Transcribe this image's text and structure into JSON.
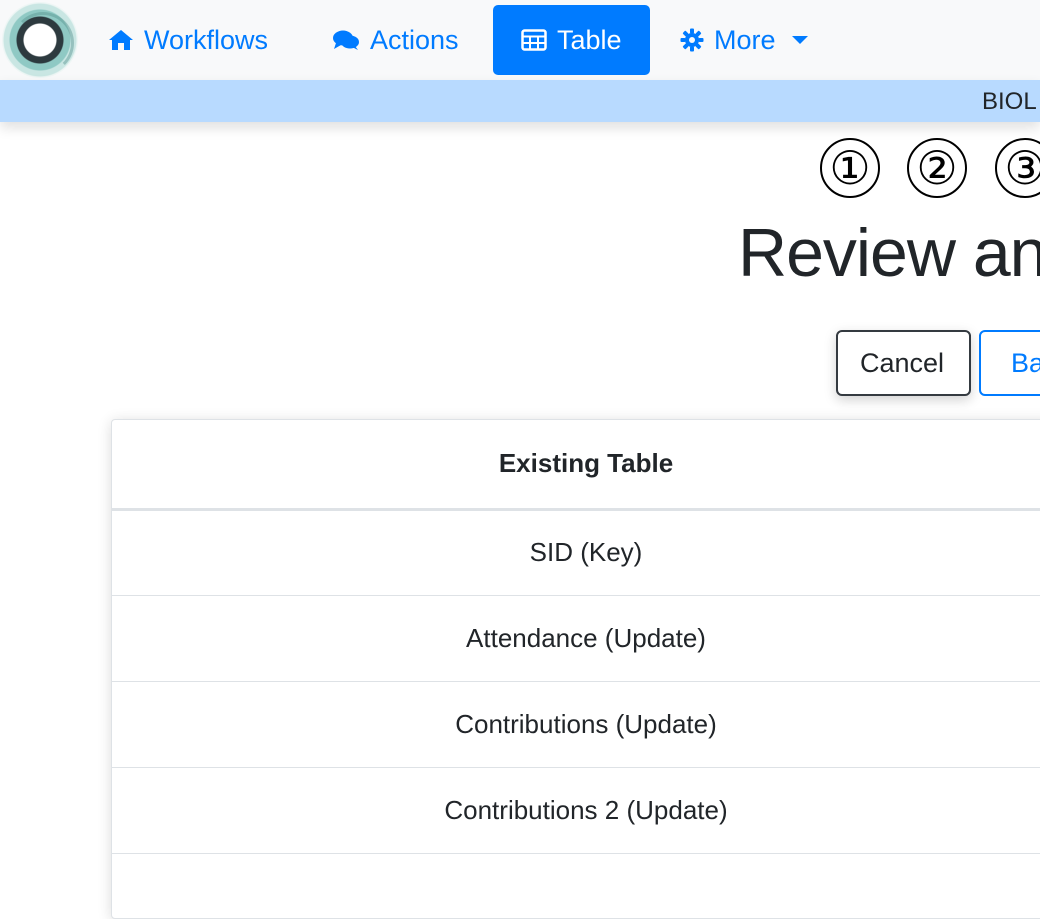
{
  "nav": {
    "items": [
      {
        "label": "Workflows",
        "icon": "home-icon"
      },
      {
        "label": "Actions",
        "icon": "comments-icon"
      },
      {
        "label": "Table",
        "icon": "table-icon",
        "active": true
      },
      {
        "label": "More",
        "icon": "gear-icon",
        "dropdown": true
      }
    ]
  },
  "infobar": {
    "text": "BIOL"
  },
  "steps": [
    "①",
    "②",
    "③"
  ],
  "page": {
    "title": "Review an"
  },
  "buttons": {
    "cancel": "Cancel",
    "back": "Ba"
  },
  "table": {
    "header": "Existing Table",
    "rows": [
      "SID (Key)",
      "Attendance (Update)",
      "Contributions (Update)",
      "Contributions 2 (Update)",
      ""
    ]
  },
  "colors": {
    "primary": "#007bff",
    "infobar": "#b8daff",
    "navbar": "#f8f9fa"
  }
}
